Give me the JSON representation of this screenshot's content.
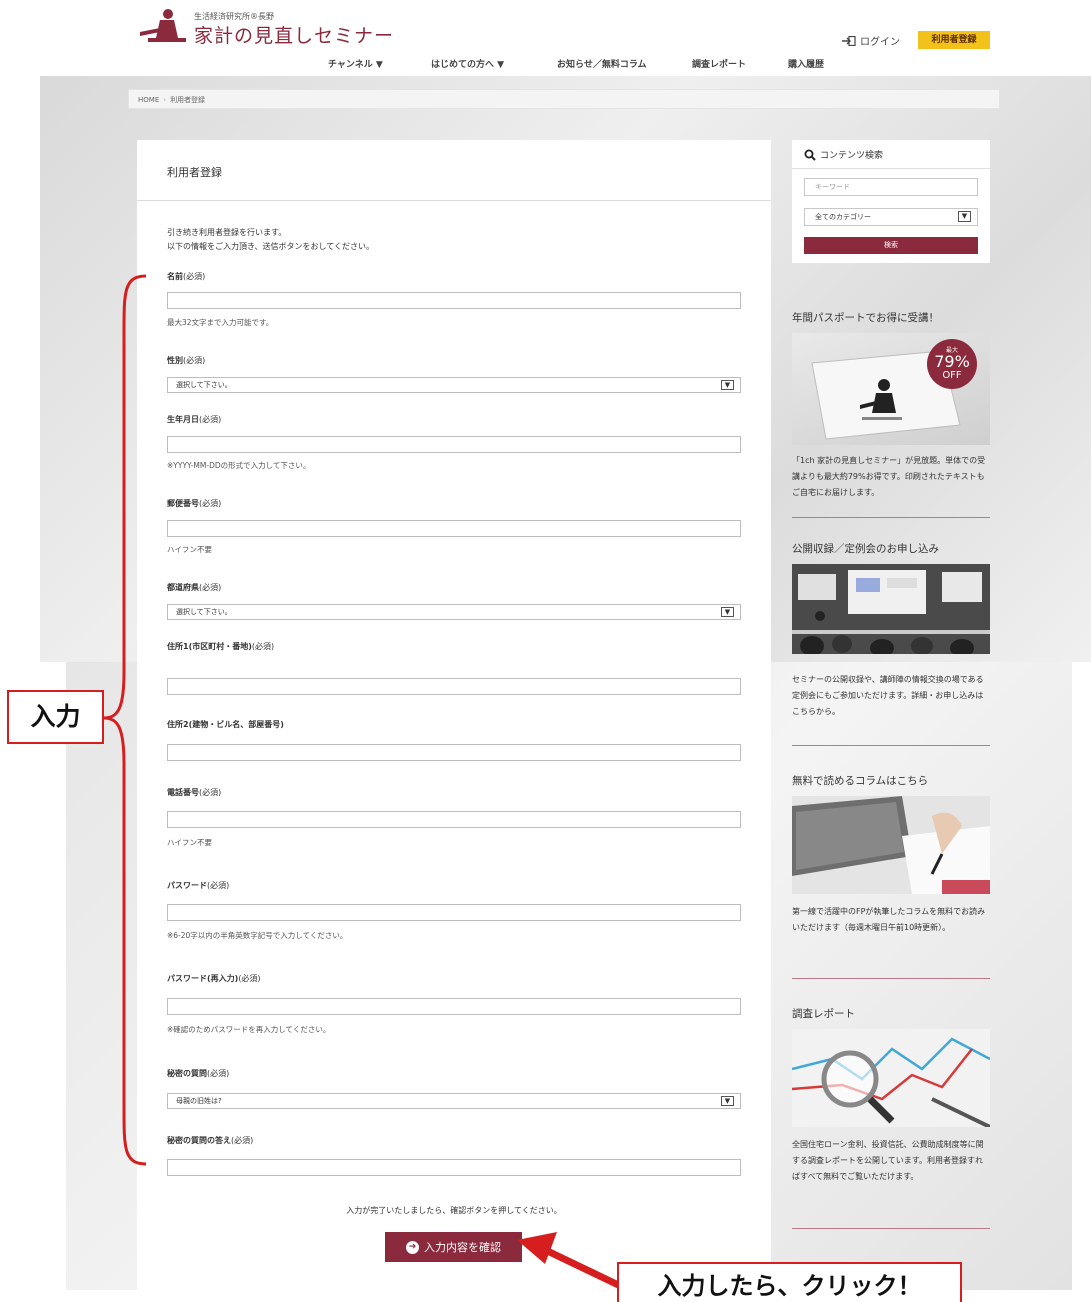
{
  "header": {
    "logo_sub": "生活経済研究所®長野",
    "logo_title": "家計の見直しセミナー",
    "login_label": "ログイン",
    "register_label": "利用者登録",
    "nav": [
      {
        "label": "チャンネル ▼"
      },
      {
        "label": "はじめての方へ ▼"
      },
      {
        "label": "お知らせ／無料コラム"
      },
      {
        "label": "調査レポート"
      },
      {
        "label": "購入履歴"
      }
    ]
  },
  "breadcrumb": {
    "home": "HOME",
    "sep": "›",
    "current": "利用者登録"
  },
  "form": {
    "title": "利用者登録",
    "intro_1": "引き続き利用者登録を行います。",
    "intro_2": "以下の情報をご入力頂き、送信ボタンをおしてください。",
    "fields": [
      {
        "label": "名前",
        "req": "(必須)",
        "help": "最大32文字まで入力可能です。"
      },
      {
        "label": "性別",
        "req": "(必須)",
        "select_value": "選択して下さい。"
      },
      {
        "label": "生年月日",
        "req": "(必須)",
        "help": "※YYYY-MM-DDの形式で入力して下さい。"
      },
      {
        "label": "郵便番号",
        "req": "(必須)",
        "help": "ハイフン不要"
      },
      {
        "label": "都道府県",
        "req": "(必須)",
        "select_value": "選択して下さい。"
      },
      {
        "label": "住所1(市区町村・番地)",
        "req": "(必須)"
      },
      {
        "label": "住所2(建物・ビル名、部屋番号)",
        "req": ""
      },
      {
        "label": "電話番号",
        "req": "(必須)",
        "help": "ハイフン不要"
      },
      {
        "label": "パスワード",
        "req": "(必須)",
        "help": "※6-20字以内の半角英数字記号で入力してください。"
      },
      {
        "label": "パスワード(再入力)",
        "req": "(必須)",
        "help": "※確認のためパスワードを再入力してください。"
      },
      {
        "label": "秘密の質問",
        "req": "(必須)",
        "select_value": "母親の旧姓は?"
      },
      {
        "label": "秘密の質問の答え",
        "req": "(必須)"
      }
    ],
    "finish_note": "入力が完了いたしましたら、確認ボタンを押してください。",
    "confirm_label": "入力内容を確認"
  },
  "sidebar": {
    "search": {
      "title": "コンテンツ検索",
      "keyword_placeholder": "キーワード",
      "category_value": "全てのカテゴリー",
      "button_label": "検索"
    },
    "widgets": [
      {
        "title": "年間パスポートでお得に受講！",
        "badge_top": "最大",
        "badge_pct": "79%",
        "badge_off": "OFF",
        "text": "「1ch 家計の見直しセミナー」が見放題。単体での受講よりも最大約79%お得です。印刷されたテキストもご自宅にお届けします。"
      },
      {
        "title": "公開収録／定例会のお申し込み",
        "text": "セミナーの公開収録や、講師陣の情報交換の場である定例会にもご参加いただけます。詳細・お申し込みはこちらから。"
      },
      {
        "title": "無料で読めるコラムはこちら",
        "text": "第一線で活躍中のFPが執筆したコラムを無料でお読みいただけます（毎週木曜日午前10時更新）。"
      },
      {
        "title": "調査レポート",
        "text": "全国住宅ローン金利、投資信託、公費助成制度等に関する調査レポートを公開しています。利用者登録すればすべて無料でご覧いただけます。"
      }
    ]
  },
  "annotations": {
    "input_label": "入力",
    "click_label": "入力したら、クリック！"
  },
  "colors": {
    "brand": "#8a2a3c",
    "accent_yellow": "#f3c21a",
    "annotation_red": "#d61e1e"
  }
}
